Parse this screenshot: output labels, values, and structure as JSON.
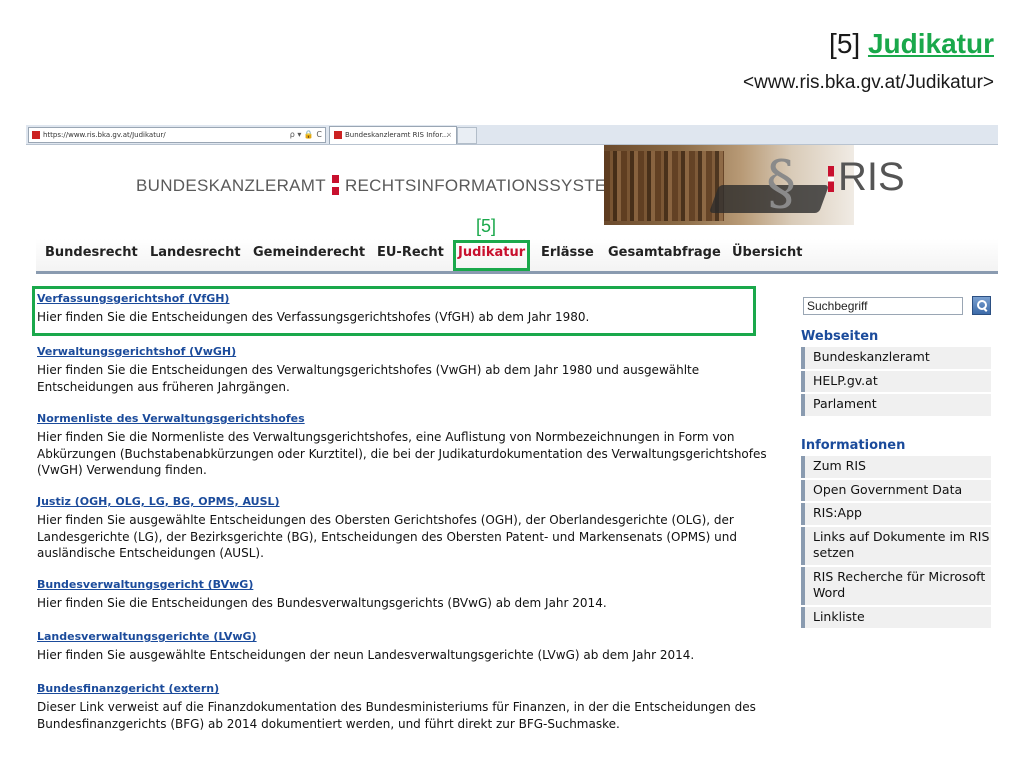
{
  "slide": {
    "title_prefix": "[5]",
    "title_link": "Judikatur",
    "url": "<www.ris.bka.gv.at/Judikatur>",
    "marker": "[5]"
  },
  "browser": {
    "address": "https://www.ris.bka.gv.at/Judikatur/",
    "address_controls": "ρ ▾ 🔒 C",
    "tab_title": "Bundeskanzleramt RIS Infor...",
    "tab_close": "×"
  },
  "header": {
    "brand_left": "BUNDESKANZLERAMT",
    "brand_right": "RECHTSINFORMATIONSSYSTEM",
    "logo_symbol": "§",
    "logo_text": "RIS"
  },
  "nav": [
    {
      "label": "Bundesrecht",
      "active": false
    },
    {
      "label": "Landesrecht",
      "active": false
    },
    {
      "label": "Gemeinderecht",
      "active": false
    },
    {
      "label": "EU-Recht",
      "active": false
    },
    {
      "label": "Judikatur",
      "active": true
    },
    {
      "label": "Erlässe",
      "active": false
    },
    {
      "label": "Gesamtabfrage",
      "active": false
    },
    {
      "label": "Übersicht",
      "active": false
    }
  ],
  "entries": [
    {
      "link": "Verfassungsgerichtshof (VfGH)",
      "desc": "Hier finden Sie die Entscheidungen des Verfassungsgerichtshofes (VfGH) ab dem Jahr 1980."
    },
    {
      "link": "Verwaltungsgerichtshof (VwGH)",
      "desc": "Hier finden Sie die Entscheidungen des Verwaltungsgerichtshofes (VwGH) ab dem Jahr 1980 und ausgewählte Entscheidungen aus früheren Jahrgängen."
    },
    {
      "link": "Normenliste des Verwaltungsgerichtshofes",
      "desc": "Hier finden Sie die Normenliste des Verwaltungsgerichtshofes, eine Auflistung von Normbezeichnungen in Form von Abkürzungen (Buchstabenabkürzungen oder Kurztitel), die bei der Judikaturdokumentation des Verwaltungsgerichtshofes (VwGH) Verwendung finden."
    },
    {
      "link": "Justiz (OGH, OLG, LG, BG, OPMS, AUSL)",
      "desc": "Hier finden Sie ausgewählte Entscheidungen des Obersten Gerichtshofes (OGH), der Oberlandesgerichte (OLG), der Landesgerichte (LG), der Bezirksgerichte (BG), Entscheidungen des Obersten Patent- und Markensenats (OPMS) und ausländische Entscheidungen (AUSL)."
    },
    {
      "link": "Bundesverwaltungsgericht (BVwG)",
      "desc": "Hier finden Sie die Entscheidungen des Bundesverwaltungsgerichts (BVwG) ab dem Jahr 2014."
    },
    {
      "link": "Landesverwaltungsgerichte (LVwG)",
      "desc": "Hier finden Sie ausgewählte Entscheidungen der neun Landesverwaltungsgerichte (LVwG) ab dem Jahr 2014."
    },
    {
      "link": "Bundesfinanzgericht (extern)",
      "desc": "Dieser Link verweist auf die Finanzdokumentation des Bundesministeriums für Finanzen, in der die Entscheidungen des Bundesfinanzgerichts (BFG) ab 2014 dokumentiert werden, und führt direkt zur BFG-Suchmaske."
    }
  ],
  "sidebar": {
    "search_value": "Suchbegriff",
    "websites_heading": "Webseiten",
    "websites": [
      "Bundeskanzleramt",
      "HELP.gv.at",
      "Parlament"
    ],
    "info_heading": "Informationen",
    "info": [
      "Zum RIS",
      "Open Government Data",
      "RIS:App",
      "Links auf Dokumente im RIS setzen",
      "RIS Recherche für Microsoft Word",
      "Linkliste"
    ]
  },
  "colors": {
    "highlight": "#1aa84b",
    "link": "#1b4b9b",
    "active_nav": "#c8102e"
  }
}
